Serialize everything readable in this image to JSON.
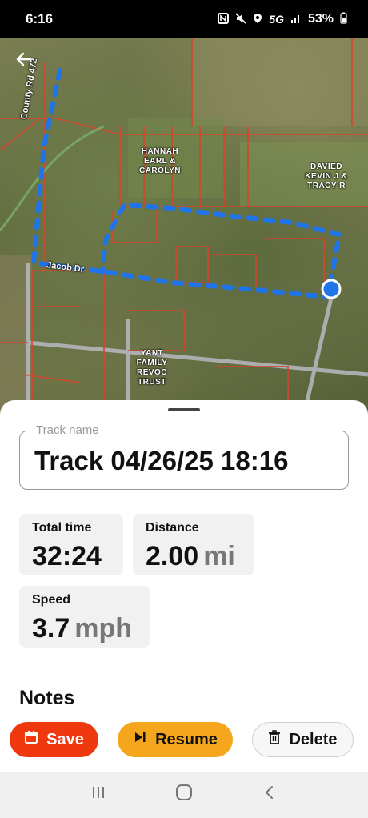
{
  "status_bar": {
    "time": "6:16",
    "network": "5G",
    "battery": "53%",
    "icons": [
      "nfc-icon",
      "mute-icon",
      "location-icon",
      "signal-icon",
      "battery-icon"
    ]
  },
  "map": {
    "labels": {
      "road_county": "County Rd 472",
      "road_jacob": "Jacob Dr",
      "owner_hannah": "HANNAH\nEARL &\nCAROLYN",
      "owner_davied": "DAVIED\nKEVIN J &\nTRACY R",
      "owner_yant": "YANT\nFAMILY\nREVOC\nTRUST"
    },
    "track_color": "#1e74e8"
  },
  "sheet": {
    "track_name_label": "Track name",
    "track_name_value": "Track 04/26/25 18:16",
    "stats": {
      "total_time_label": "Total time",
      "total_time_value": "32:24",
      "distance_label": "Distance",
      "distance_value": "2.00",
      "distance_unit": "mi",
      "speed_label": "Speed",
      "speed_value": "3.7",
      "speed_unit": "mph"
    },
    "notes_label": "Notes",
    "buttons": {
      "save": "Save",
      "resume": "Resume",
      "delete": "Delete"
    }
  },
  "colors": {
    "save": "#f0380f",
    "resume": "#f4a61c",
    "delete_bg": "#f7f7f7"
  }
}
